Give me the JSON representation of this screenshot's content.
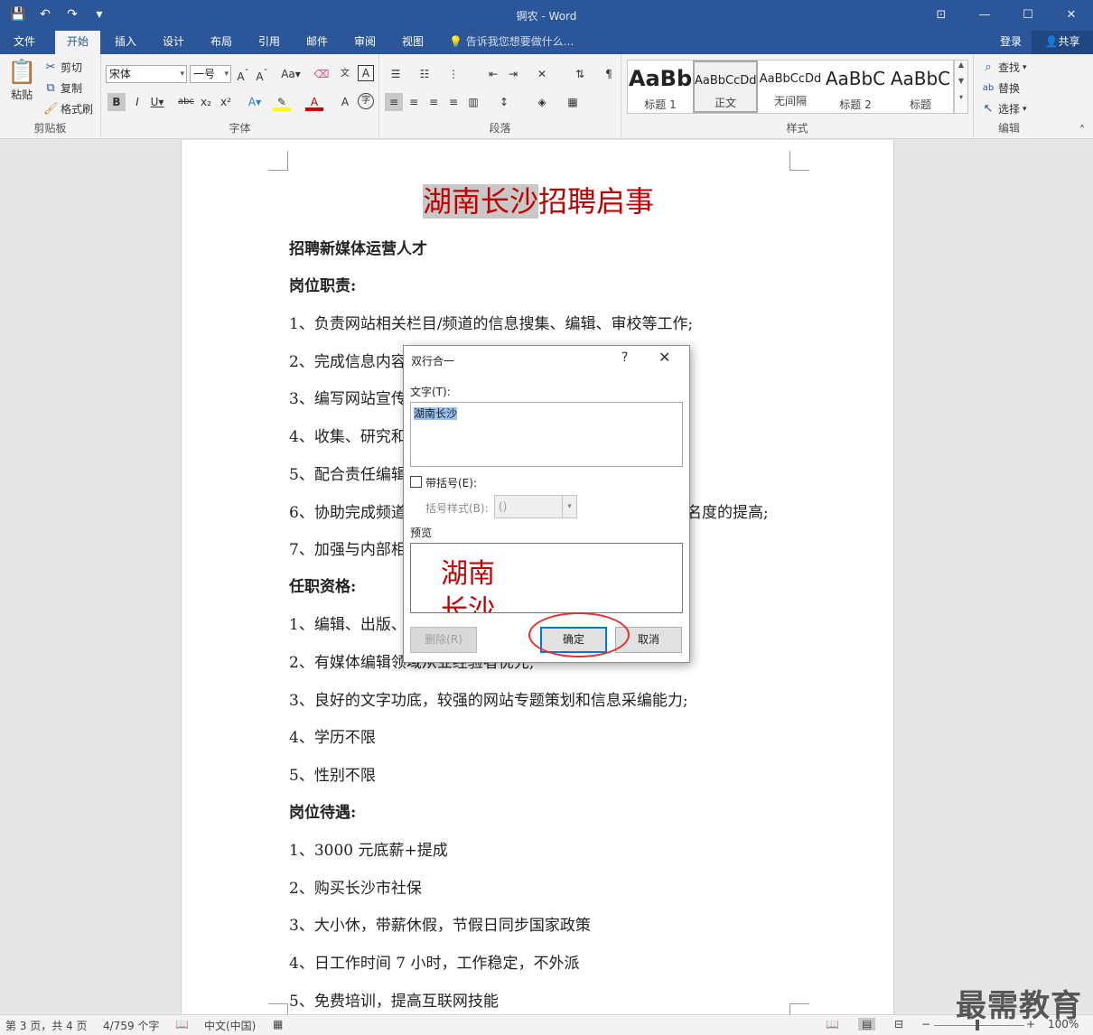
{
  "window": {
    "title": "锕农 - Word"
  },
  "qat": {
    "save": "💾",
    "undo": "↶",
    "redo": "↷",
    "customize": "▾"
  },
  "tabs": {
    "file": "文件",
    "home": "开始",
    "insert": "插入",
    "design": "设计",
    "layout": "布局",
    "references": "引用",
    "mailings": "邮件",
    "review": "审阅",
    "view": "视图",
    "tellme": "告诉我您想要做什么...",
    "login": "登录",
    "share": "共享"
  },
  "clipboard": {
    "paste": "粘贴",
    "cut": "剪切",
    "copy": "复制",
    "painter": "格式刷",
    "label": "剪贴板"
  },
  "font": {
    "name": "宋体",
    "size": "一号",
    "label": "字体"
  },
  "paragraph": {
    "label": "段落"
  },
  "styles": {
    "label": "样式",
    "items": [
      {
        "preview": "AaBb",
        "name": "标题 1"
      },
      {
        "preview": "AaBbCcDd",
        "name": "正文"
      },
      {
        "preview": "AaBbCcDd",
        "name": "无间隔"
      },
      {
        "preview": "AaBbC",
        "name": "标题 2"
      },
      {
        "preview": "AaBbC",
        "name": "标题"
      }
    ]
  },
  "editing": {
    "find": "查找",
    "replace": "替换",
    "select": "选择",
    "label": "编辑"
  },
  "document": {
    "title_highlight": "湖南长沙",
    "title_rest": "招聘启事",
    "lines": [
      {
        "text": "招聘新媒体运营人才",
        "bold": true
      },
      {
        "text": "岗位职责:",
        "bold": true
      },
      {
        "text": "1、负责网站相关栏目/频道的信息搜集、编辑、审校等工作;",
        "bold": false
      },
      {
        "text": "2、完成信息内容",
        "bold": false
      },
      {
        "text": "3、编写网站宣传",
        "bold": false
      },
      {
        "text": "4、收集、研究和",
        "bold": false
      },
      {
        "text": "5、配合责任编辑",
        "bold": false
      },
      {
        "text": "6、协助完成频道",
        "suffix": "名度的提高;",
        "bold": false
      },
      {
        "text": "7、加强与内部相",
        "bold": false
      },
      {
        "text": "任职资格:",
        "bold": true
      },
      {
        "text": "1、编辑、出版、",
        "bold": false
      },
      {
        "text": "2、有媒体编辑领域从业经验者优先;",
        "bold": false
      },
      {
        "text": "3、良好的文字功底，较强的网站专题策划和信息采编能力;",
        "bold": false
      },
      {
        "text": "4、学历不限",
        "bold": false
      },
      {
        "text": "5、性别不限",
        "bold": false
      },
      {
        "text": "岗位待遇:",
        "bold": true
      },
      {
        "text": "1、3000 元底薪+提成",
        "bold": false
      },
      {
        "text": "2、购买长沙市社保",
        "bold": false
      },
      {
        "text": "3、大小休，带薪休假，节假日同步国家政策",
        "bold": false
      },
      {
        "text": "4、日工作时间 7 小时，工作稳定，不外派",
        "bold": false
      },
      {
        "text": "5、免费培训，提高互联网技能",
        "bold": false
      }
    ]
  },
  "dialog": {
    "title": "双行合一",
    "help": "?",
    "close": "✕",
    "text_label": "文字(T):",
    "text_value": "湖南长沙",
    "bracket_label": "带括号(E):",
    "bracket_style_label": "括号样式(B):",
    "bracket_style_value": "()",
    "preview_label": "预览",
    "preview_text": "湖南长沙",
    "delete": "删除(R)",
    "ok": "确定",
    "cancel": "取消"
  },
  "status": {
    "page": "第 3 页，共 4 页",
    "words": "4/759 个字",
    "language": "中文(中国)",
    "zoom": "100%"
  },
  "watermark": "最需教育"
}
